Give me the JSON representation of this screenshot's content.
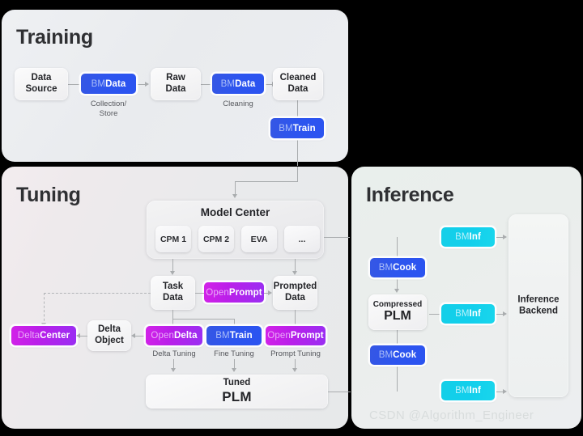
{
  "panels": {
    "training": {
      "title": "Training"
    },
    "tuning": {
      "title": "Tuning"
    },
    "inference": {
      "title": "Inference"
    }
  },
  "training": {
    "nodes": [
      {
        "id": "data-source",
        "line1": "Data",
        "line2": "Source"
      },
      {
        "id": "raw-data",
        "line1": "Raw",
        "line2": "Data"
      },
      {
        "id": "cleaned-data",
        "line1": "Cleaned",
        "line2": "Data"
      }
    ],
    "chips": [
      {
        "id": "bmdata-collection",
        "pre": "BM",
        "post": "Data",
        "color": "#2d55ef"
      },
      {
        "id": "bmdata-cleaning",
        "pre": "BM",
        "post": "Data",
        "color": "#2d55ef"
      },
      {
        "id": "bmtrain",
        "pre": "BM",
        "post": "Train",
        "color": "#2d55ef"
      }
    ],
    "captions": [
      {
        "id": "collection-store",
        "line1": "Collection/",
        "line2": "Store"
      },
      {
        "id": "cleaning",
        "line1": "Cleaning",
        "line2": ""
      }
    ]
  },
  "tuning": {
    "model_center": {
      "title": "Model Center",
      "items": [
        "CPM 1",
        "CPM 2",
        "EVA",
        "..."
      ]
    },
    "nodes": [
      {
        "id": "task-data",
        "line1": "Task",
        "line2": "Data"
      },
      {
        "id": "prompted-data",
        "line1": "Prompted",
        "line2": "Data"
      },
      {
        "id": "delta-object",
        "line1": "Delta",
        "line2": "Object"
      },
      {
        "id": "tuned-plm",
        "line1": "Tuned",
        "line2": "PLM"
      }
    ],
    "chips": [
      {
        "id": "openprompt-top",
        "pre": "Open",
        "post": "Prompt",
        "color": "#bb1fe9"
      },
      {
        "id": "delta-center",
        "pre": "Delta ",
        "post": "Center",
        "color": "#bb1fe9"
      },
      {
        "id": "opendelta",
        "pre": "Open",
        "post": "Delta",
        "color": "#bb1fe9"
      },
      {
        "id": "bmtrain-tuning",
        "pre": "BM",
        "post": "Train",
        "color": "#2d55ef"
      },
      {
        "id": "openprompt-bottom",
        "pre": "Open",
        "post": "Prompt",
        "color": "#bb1fe9"
      }
    ],
    "captions": [
      {
        "id": "delta-tuning",
        "text": "Delta Tuning"
      },
      {
        "id": "fine-tuning",
        "text": "Fine Tuning"
      },
      {
        "id": "prompt-tuning",
        "text": "Prompt Tuning"
      }
    ]
  },
  "inference": {
    "nodes": [
      {
        "id": "compressed-plm",
        "line1": "Compressed",
        "line2": "PLM"
      },
      {
        "id": "inference-backend",
        "line1": "Inference",
        "line2": "Backend"
      }
    ],
    "chips": [
      {
        "id": "bminf-top",
        "pre": "BM",
        "post": "Inf",
        "color": "#12cfec"
      },
      {
        "id": "bmcook-top",
        "pre": "BM",
        "post": "Cook",
        "color": "#2d55ef"
      },
      {
        "id": "bminf-middle",
        "pre": "BM",
        "post": "Inf",
        "color": "#12cfec"
      },
      {
        "id": "bmcook-bottom",
        "pre": "BM",
        "post": "Cook",
        "color": "#2d55ef"
      },
      {
        "id": "bminf-bottom",
        "pre": "BM",
        "post": "Inf",
        "color": "#12cfec"
      }
    ]
  },
  "watermark": {
    "text": "CSDN @Algorithm_Engineer"
  }
}
